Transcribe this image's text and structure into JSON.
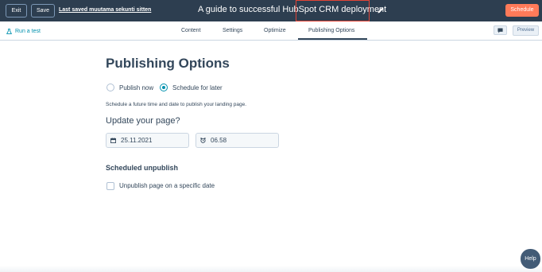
{
  "topbar": {
    "exit_label": "Exit",
    "save_label": "Save",
    "last_saved": "Last saved muutama sekunti sitten",
    "title": "A guide to successful HubSpot CRM deployment",
    "schedule_label": "Schedule"
  },
  "tabbar": {
    "run_test_label": "Run a test",
    "tabs": [
      {
        "label": "Content"
      },
      {
        "label": "Settings"
      },
      {
        "label": "Optimize"
      },
      {
        "label": "Publishing Options",
        "active": true
      }
    ],
    "preview_label": "Preview"
  },
  "main": {
    "heading": "Publishing Options",
    "publish_options": [
      {
        "label": "Publish now",
        "checked": false
      },
      {
        "label": "Schedule for later",
        "checked": true
      }
    ],
    "description": "Schedule a future time and date to publish your landing page.",
    "update_heading": "Update your page?",
    "date_value": "25.11.2021",
    "time_value": "06.58",
    "unpublish_heading": "Scheduled unpublish",
    "unpublish_checkbox_label": "Unpublish page on a specific date"
  },
  "help_label": "Help",
  "colors": {
    "topbar_bg": "#2d3e50",
    "accent_orange": "#ff7a59",
    "link_teal": "#0091ae",
    "highlight_red": "#e34436",
    "text_dark": "#33475b"
  },
  "icons": [
    "pencil-icon",
    "flask-icon",
    "comment-icon",
    "calendar-icon",
    "clock-icon"
  ]
}
